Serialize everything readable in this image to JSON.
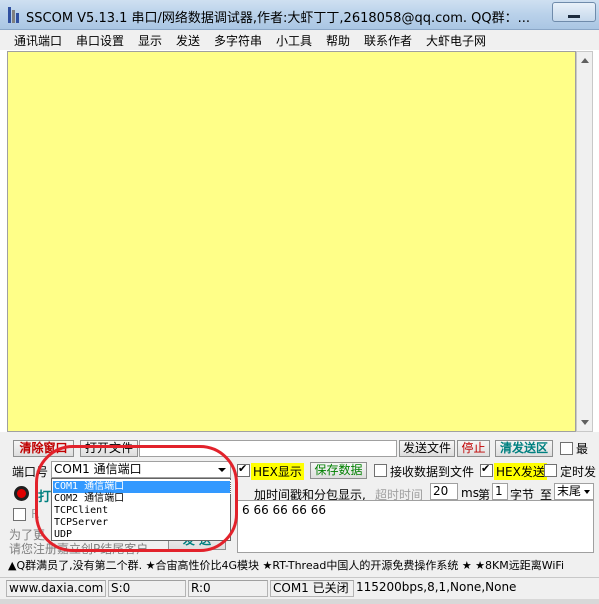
{
  "window": {
    "title": "SSCOM V5.13.1 串口/网络数据调试器,作者:大虾丁丁,2618058@qq.com. QQ群：..."
  },
  "menu": {
    "items": [
      "通讯端口",
      "串口设置",
      "显示",
      "发送",
      "多字符串",
      "小工具",
      "帮助",
      "联系作者",
      "大虾电子网"
    ]
  },
  "receive": {
    "text": ""
  },
  "controls": {
    "clear_window": "清除窗口",
    "open_file": "打开文件",
    "file_path": "",
    "send_file": "发送文件",
    "stop": "停止",
    "clear_send_area": "清发送区",
    "topmost": "最",
    "port_label": "端口号",
    "port_value": "COM1 通信端口",
    "hex_display": "HEX显示",
    "save_data": "保存数据",
    "save_to_file": "接收数据到文件",
    "hex_send": "HEX发送",
    "timed_send": "定时发",
    "open_port_char": "打",
    "timestamp_label": "加时间戳和分包显示,",
    "timeout_label": "超时时间",
    "timeout_value": "20",
    "timeout_unit": "ms",
    "byte_prefix": "第",
    "byte_index": "1",
    "byte_unit": "字节",
    "to_label": "至",
    "tail_option": "末尾",
    "rts_char": "R",
    "note_line1": "为了更",
    "note_line2": "请您注册嘉立创P结尾客户",
    "send_button": "发 送",
    "send_text": "6 66 66 66 66"
  },
  "dropdown": {
    "options": [
      "COM1 通信端口",
      "COM2 通信端口",
      "TCPClient",
      "TCPServer",
      "UDP"
    ],
    "selected_index": 0
  },
  "banner": {
    "text": "▲Q群满员了,没有第二个群. ★合宙高性价比4G模块 ★RT-Thread中国人的开源免费操作系统 ★ ★8KM远距离WiFi"
  },
  "status": {
    "website": "www.daxia.com",
    "sent": "S:0",
    "received": "R:0",
    "port_state": "COM1 已关闭",
    "settings": "115200bps,8,1,None,None"
  },
  "colors": {
    "receive_bg": "#ffff88",
    "highlight_circle": "#e2222b",
    "hex_label_bg": "#ffff00"
  }
}
